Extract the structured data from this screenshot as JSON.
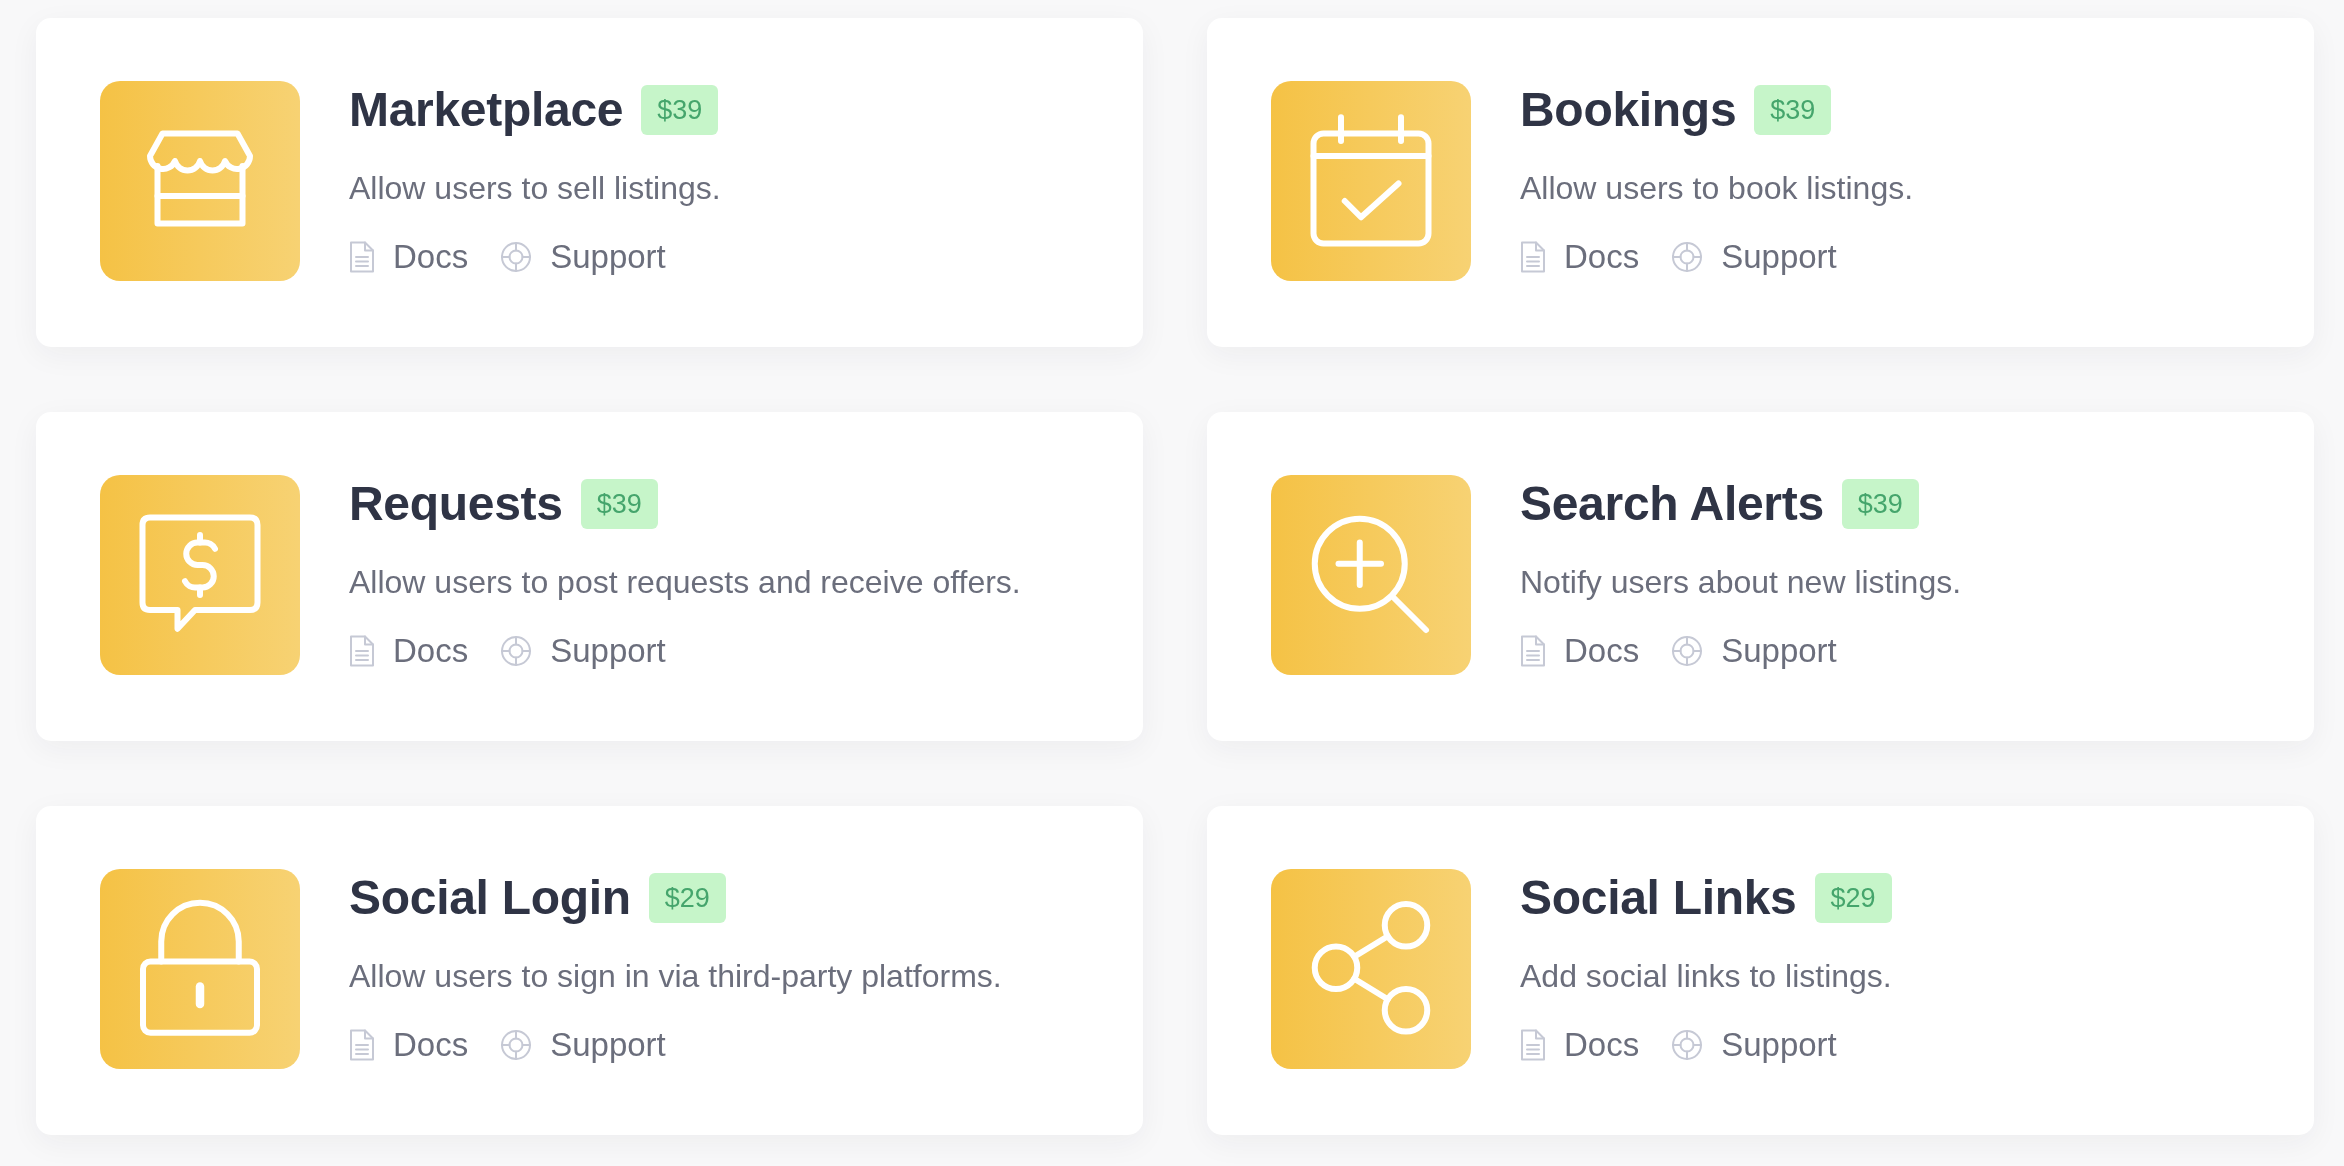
{
  "cards": [
    {
      "kind": "store",
      "title": "Marketplace",
      "price": "$39",
      "description": "Allow users to sell listings.",
      "links": [
        {
          "kind": "docs",
          "label": "Docs"
        },
        {
          "kind": "support",
          "label": "Support"
        }
      ]
    },
    {
      "kind": "calendar",
      "title": "Bookings",
      "price": "$39",
      "description": "Allow users to book listings.",
      "links": [
        {
          "kind": "docs",
          "label": "Docs"
        },
        {
          "kind": "support",
          "label": "Support"
        }
      ]
    },
    {
      "kind": "offer",
      "title": "Requests",
      "price": "$39",
      "description": "Allow users to post requests and receive offers.",
      "links": [
        {
          "kind": "docs",
          "label": "Docs"
        },
        {
          "kind": "support",
          "label": "Support"
        }
      ]
    },
    {
      "kind": "alert",
      "title": "Search Alerts",
      "price": "$39",
      "description": "Notify users about new listings.",
      "links": [
        {
          "kind": "docs",
          "label": "Docs"
        },
        {
          "kind": "support",
          "label": "Support"
        }
      ]
    },
    {
      "kind": "login",
      "title": "Social Login",
      "price": "$29",
      "description": "Allow users to sign in via third-party platforms.",
      "links": [
        {
          "kind": "docs",
          "label": "Docs"
        },
        {
          "kind": "support",
          "label": "Support"
        }
      ]
    },
    {
      "kind": "share",
      "title": "Social Links",
      "price": "$29",
      "description": "Add social links to listings.",
      "links": [
        {
          "kind": "docs",
          "label": "Docs"
        },
        {
          "kind": "support",
          "label": "Support"
        }
      ]
    }
  ]
}
